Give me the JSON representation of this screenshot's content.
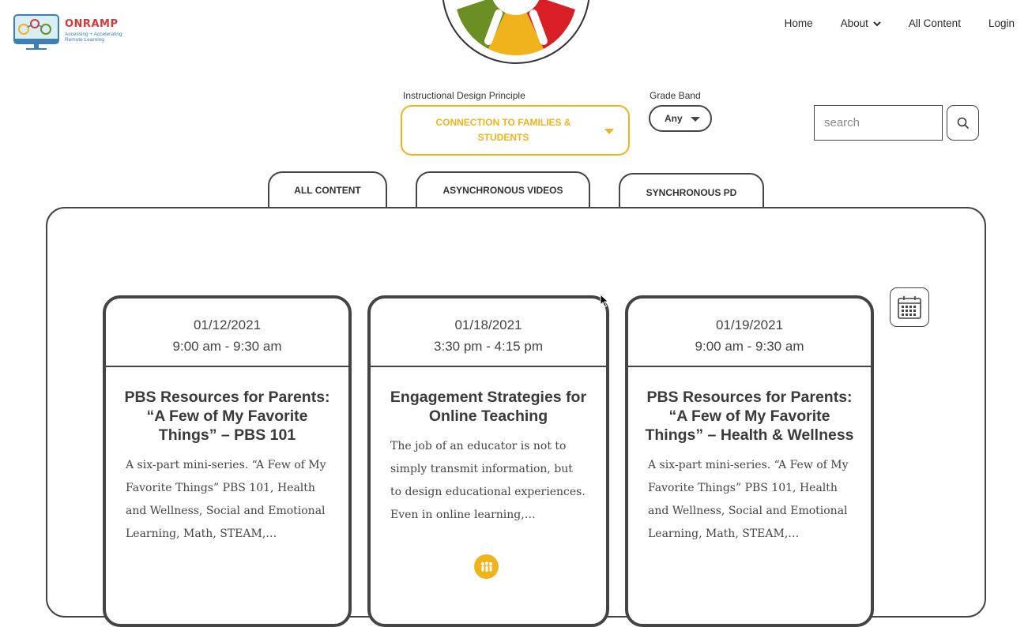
{
  "brand": {
    "name": "ONRAMP",
    "tagline": "Accessing + Accelerating Remote Learning"
  },
  "nav": {
    "items": [
      {
        "label": "Home"
      },
      {
        "label": "About",
        "has_dropdown": true
      },
      {
        "label": "All Content"
      },
      {
        "label": "Login"
      }
    ]
  },
  "filters": {
    "principle_label": "Instructional Design Principle",
    "principle_value": "CONNECTION TO FAMILIES & STUDENTS",
    "grade_label": "Grade Band",
    "grade_value": "Any",
    "search_placeholder": "search"
  },
  "tabs": [
    {
      "label": "ALL CONTENT"
    },
    {
      "label": "ASYNCHRONOUS VIDEOS"
    },
    {
      "label": "SYNCHRONOUS PD"
    }
  ],
  "cards": [
    {
      "date": "01/12/2021",
      "time": "9:00 am - 9:30 am",
      "title": "PBS Resources for Parents: “A Few of My Favorite Things” – PBS 101",
      "description": "A six-part mini-series. “A Few of My Favorite Things” PBS 101, Health and Wellness, Social and Emotional Learning, Math, STEAM,…"
    },
    {
      "date": "01/18/2021",
      "time": "3:30 pm - 4:15 pm",
      "title": "Engagement Strategies for Online Teaching",
      "description": "The job of an educator is not to simply transmit information, but to design educational experiences. Even in online learning,…",
      "icon": "families-icon"
    },
    {
      "date": "01/19/2021",
      "time": "9:00 am - 9:30 am",
      "title": "PBS Resources for Parents: “A Few of My Favorite Things” – Health & Wellness",
      "description": "A six-part mini-series. “A Few of My Favorite Things” PBS 101, Health and Wellness, Social and Emotional Learning, Math, STEAM,…"
    }
  ],
  "colors": {
    "accent": "#f0b31c",
    "brand_red": "#d23a3a",
    "brand_blue": "#3a7fb8",
    "wheel_green": "#6b8f23",
    "wheel_red": "#d81f26",
    "border": "#444444"
  }
}
